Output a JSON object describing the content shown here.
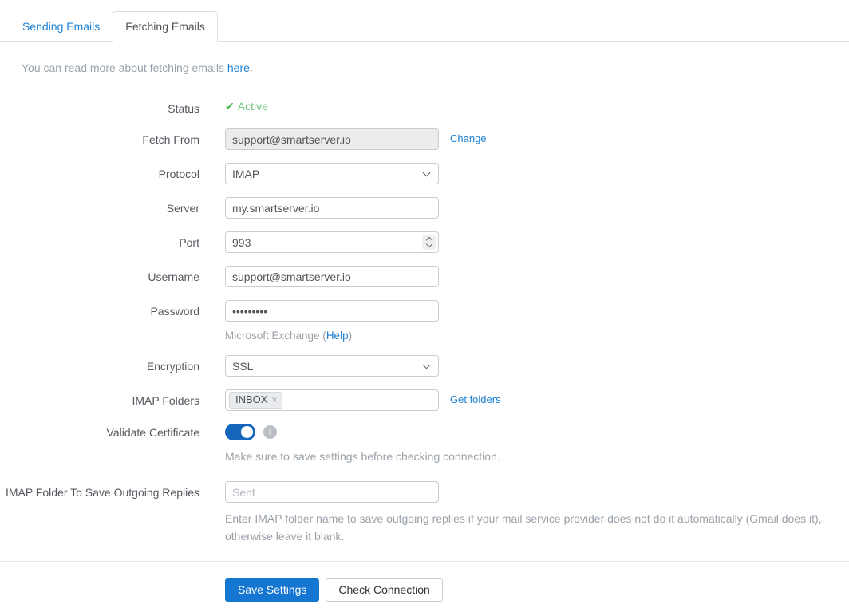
{
  "tabs": {
    "sending": "Sending Emails",
    "fetching": "Fetching Emails"
  },
  "intro": {
    "text_before": "You can read more about fetching emails ",
    "link": "here",
    "text_after": "."
  },
  "form": {
    "status": {
      "label": "Status",
      "check_icon": "✔",
      "value": "Active"
    },
    "fetch_from": {
      "label": "Fetch From",
      "value": "support@smartserver.io",
      "action": "Change"
    },
    "protocol": {
      "label": "Protocol",
      "value": "IMAP"
    },
    "server": {
      "label": "Server",
      "value": "my.smartserver.io"
    },
    "port": {
      "label": "Port",
      "value": "993"
    },
    "username": {
      "label": "Username",
      "value": "support@smartserver.io"
    },
    "password": {
      "label": "Password",
      "value": "•••••••••",
      "hint_before": "Microsoft Exchange (",
      "hint_link": "Help",
      "hint_after": ")"
    },
    "encryption": {
      "label": "Encryption",
      "value": "SSL"
    },
    "imap_folders": {
      "label": "IMAP Folders",
      "chip": "INBOX",
      "chip_remove": "×",
      "action": "Get folders"
    },
    "validate_certificate": {
      "label": "Validate Certificate",
      "state": "on",
      "info_icon": "i",
      "note": "Make sure to save settings before checking connection."
    },
    "outgoing_folder": {
      "label": "IMAP Folder To Save Outgoing Replies",
      "placeholder": "Sent",
      "help": "Enter IMAP folder name to save outgoing replies if your mail service provider does not do it automatically (Gmail does it), otherwise leave it blank."
    }
  },
  "buttons": {
    "save": "Save Settings",
    "check": "Check Connection"
  },
  "colors": {
    "link_blue": "#1e80d2",
    "primary_button_blue": "#1677d2",
    "toggle_blue": "#1566bd",
    "success_green": "#47b94d",
    "muted_text": "#9aa2aa",
    "tab_border": "#dddddd"
  }
}
